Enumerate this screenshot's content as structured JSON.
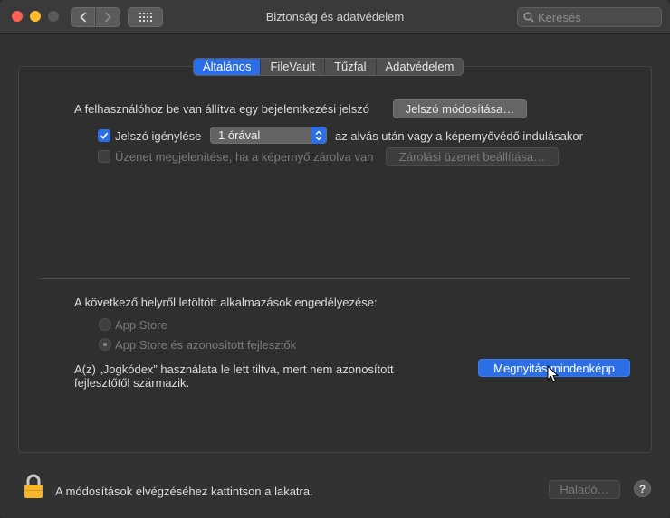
{
  "window": {
    "title": "Biztonság és adatvédelem",
    "search_placeholder": "Keresés"
  },
  "tabs": [
    {
      "label": "Általános",
      "active": true
    },
    {
      "label": "FileVault",
      "active": false
    },
    {
      "label": "Tűzfal",
      "active": false
    },
    {
      "label": "Adatvédelem",
      "active": false
    }
  ],
  "general": {
    "password_set_text": "A felhasználóhoz be van állítva egy bejelentkezési jelszó",
    "change_password_button": "Jelszó módosítása…",
    "require_password_label": "Jelszó igénylése",
    "require_password_checked": true,
    "require_password_delay": "1 órával",
    "require_password_suffix": "az alvás után vagy a képernyővédő indulásakor",
    "show_message_label": "Üzenet megjelenítése, ha a képernyő zárolva van",
    "show_message_checked": false,
    "lock_message_button": "Zárolási üzenet beállítása…"
  },
  "downloads": {
    "heading": "A következő helyről letöltött alkalmazások engedélyezése:",
    "options": [
      {
        "label": "App Store",
        "selected": false
      },
      {
        "label": "App Store és azonosított fejlesztők",
        "selected": true
      }
    ],
    "blocked_line1": "A(z) „Jogkódex” használata le lett tiltva, mert nem azonosított",
    "blocked_line2": "fejlesztőtől származik.",
    "open_anyway_button": "Megnyitás mindenképp"
  },
  "footer": {
    "lock_text": "A módosítások elvégzéséhez kattintson a lakatra.",
    "advanced_button": "Haladó…",
    "help_label": "?"
  },
  "colors": {
    "accent": "#2c6ee6",
    "lock": "#f5b62c"
  }
}
